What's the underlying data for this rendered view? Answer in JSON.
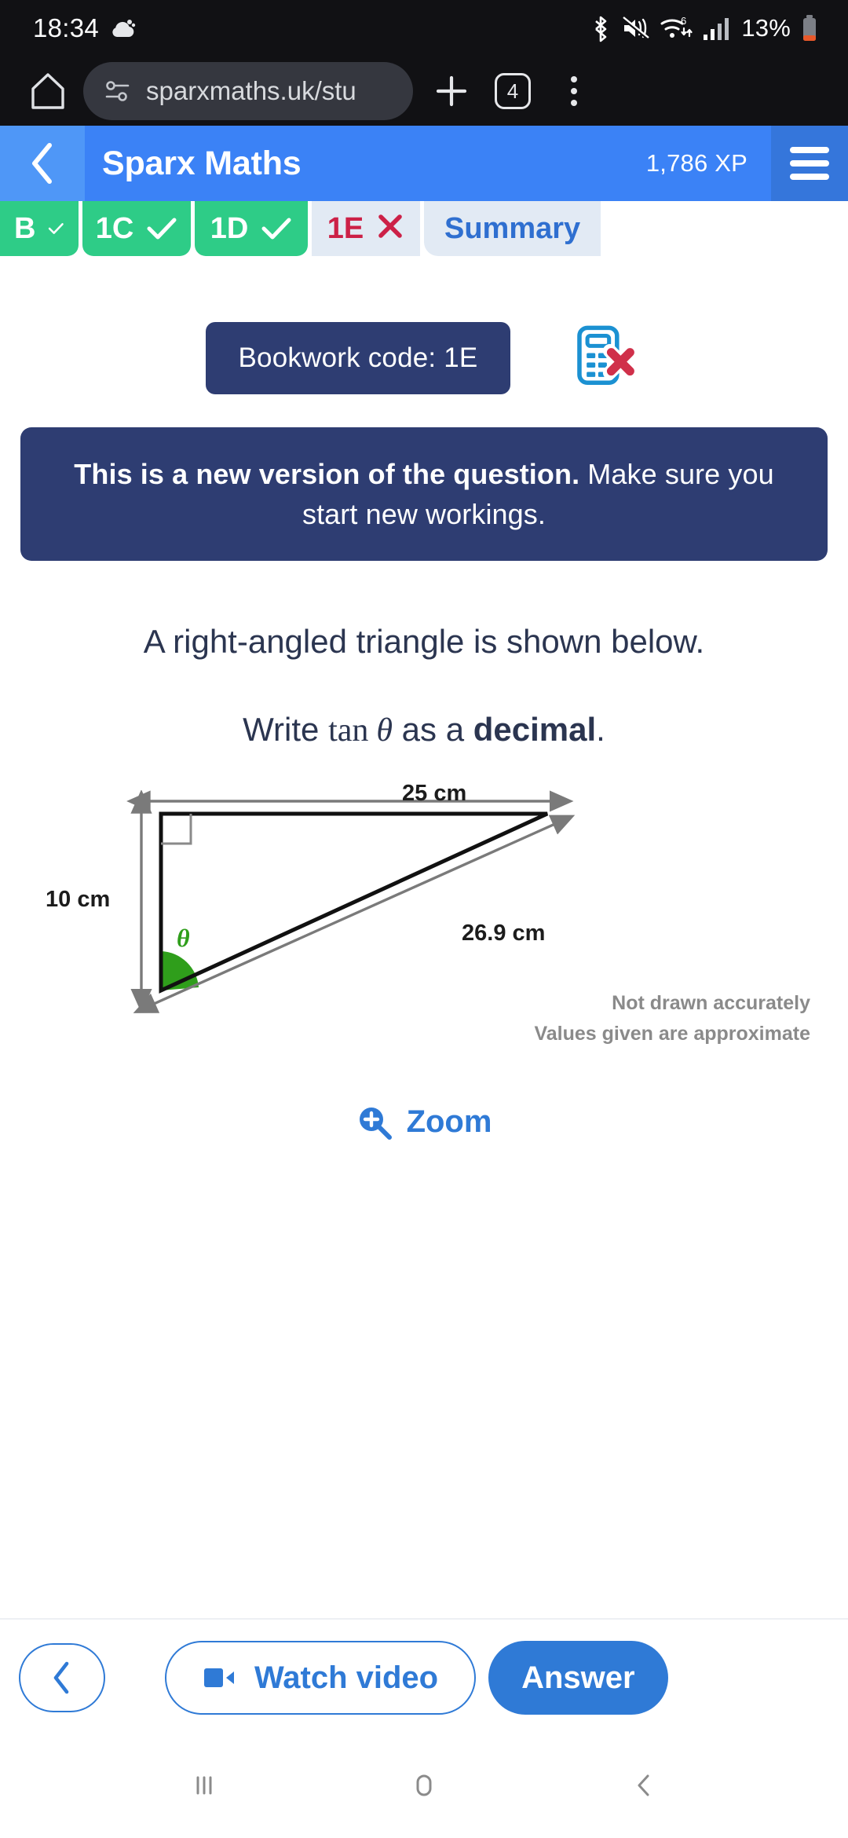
{
  "status_bar": {
    "time": "18:34",
    "weather_icon": "cloud-icon",
    "bluetooth_icon": "bluetooth-icon",
    "mute_icon": "volume-mute-icon",
    "wifi_icon": "wifi-6-icon",
    "signal_icon": "cellular-signal-icon",
    "battery_percent": "13%",
    "battery_icon": "battery-low-icon"
  },
  "browser": {
    "home_icon": "home-icon",
    "site_info_icon": "site-settings-icon",
    "url": "sparxmaths.uk/stu",
    "new_tab_icon": "plus-icon",
    "tab_count": "4",
    "menu_icon": "kebab-menu-icon"
  },
  "app_header": {
    "back_icon": "chevron-left-icon",
    "title": "Sparx Maths",
    "xp": "1,786 XP",
    "menu_icon": "hamburger-menu-icon"
  },
  "tabs": [
    {
      "label": "B",
      "state": "complete",
      "status_icon": "check-icon"
    },
    {
      "label": "1C",
      "state": "complete",
      "status_icon": "check-icon"
    },
    {
      "label": "1D",
      "state": "complete",
      "status_icon": "check-icon"
    },
    {
      "label": "1E",
      "state": "incorrect",
      "status_icon": "cross-icon"
    },
    {
      "label": "Summary",
      "state": "link",
      "status_icon": ""
    }
  ],
  "question": {
    "bookwork_code": "Bookwork code: 1E",
    "no_calculator_icon": "no-calculator-icon",
    "new_version_bold": "This is a new version of the question.",
    "new_version_rest": " Make sure you start new workings.",
    "line1": "A right-angled triangle is shown below.",
    "line2_prefix": "Write ",
    "line2_fn": "tan",
    "line2_theta": "θ",
    "line2_mid": " as a ",
    "line2_bold": "decimal",
    "line2_suffix": "."
  },
  "diagram": {
    "top_label": "25 cm",
    "left_label": "10 cm",
    "hyp_label": "26.9 cm",
    "angle_label": "θ",
    "note1": "Not drawn accurately",
    "note2": "Values given are approximate",
    "right_angle_marker": "right-angle-marker"
  },
  "zoom_control": {
    "icon": "zoom-in-icon",
    "label": "Zoom"
  },
  "actions": {
    "prev_icon": "chevron-left-icon",
    "watch_icon": "video-camera-icon",
    "watch_label": "Watch video",
    "answer_label": "Answer"
  },
  "nav_bar": {
    "recents_icon": "recents-icon",
    "home_icon": "home-circle-icon",
    "back_icon": "back-chevron-icon"
  },
  "colors": {
    "header_blue": "#3b82f6",
    "tab_green": "#2ecc87",
    "active_tab_bg": "#e2eaf4",
    "incorrect_red": "#cc2147",
    "navy": "#2e3d72",
    "link_blue": "#2f7ad6",
    "angle_green": "#2f9e1b"
  }
}
